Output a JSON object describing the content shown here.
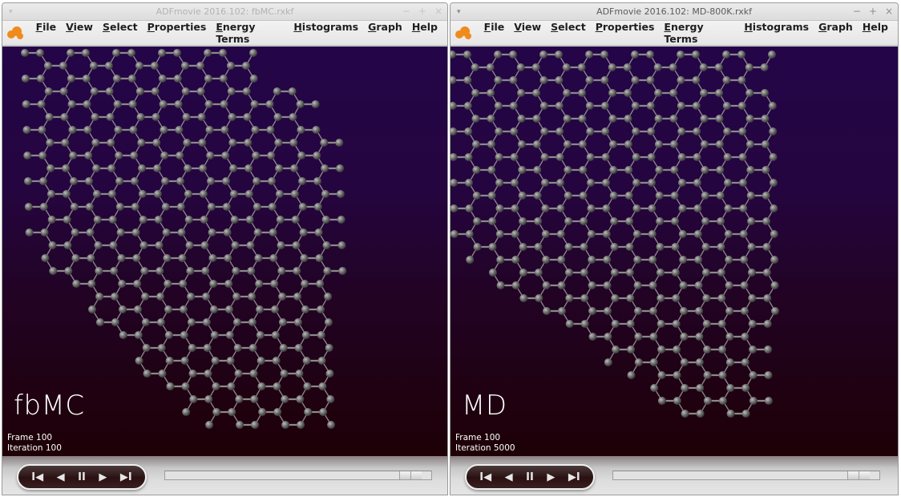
{
  "windows": [
    {
      "title": "ADFmovie 2016.102: fbMC.rxkf",
      "active": false,
      "menu": [
        "File",
        "View",
        "Select",
        "Properties",
        "Energy Terms",
        "Histograms",
        "Graph",
        "Help"
      ],
      "overlay_label": "fbMC",
      "frame_text": "Frame 100",
      "iteration_text": "Iteration 100",
      "controls": [
        "first-frame",
        "previous-frame",
        "pause",
        "next-frame",
        "last-frame"
      ],
      "progress_fraction": 0.96
    },
    {
      "title": "ADFmovie 2016.102: MD-800K.rxkf",
      "active": true,
      "menu": [
        "File",
        "View",
        "Select",
        "Properties",
        "Energy Terms",
        "Histograms",
        "Graph",
        "Help"
      ],
      "overlay_label": "MD",
      "frame_text": "Frame 100",
      "iteration_text": "Iteration 5000",
      "controls": [
        "first-frame",
        "previous-frame",
        "pause",
        "next-frame",
        "last-frame"
      ],
      "progress_fraction": 0.96
    }
  ],
  "window_buttons": [
    "−",
    "+",
    "×"
  ],
  "window_menu_glyph": "▾",
  "player_glyphs": [
    "I◀",
    "◀",
    "II",
    "▶",
    "▶I"
  ],
  "colors": {
    "atom": "#7a7a7a",
    "bond": "#8a8a8a",
    "logo": "#f08a1c",
    "viewport_top": "#240548",
    "viewport_bottom": "#1e0006"
  }
}
